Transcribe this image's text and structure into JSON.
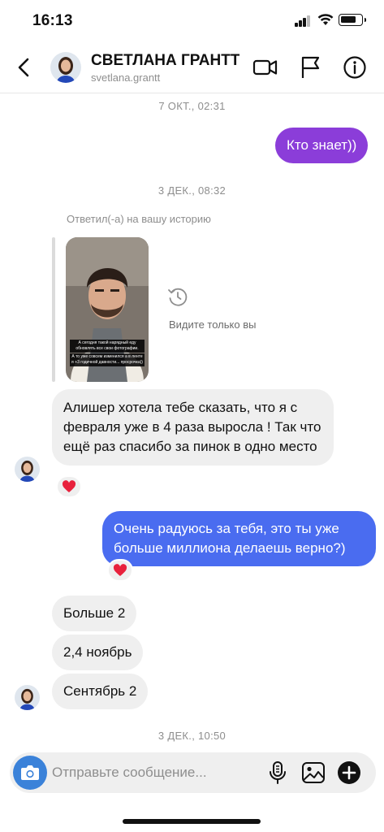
{
  "status_bar": {
    "time": "16:13"
  },
  "header": {
    "contact_name": "СВЕТЛАНА ГРАНТТ",
    "username": "svetlana.grantt",
    "icons": [
      "back-icon",
      "video-call-icon",
      "flag-icon",
      "info-icon"
    ]
  },
  "colors": {
    "outgoing_purple": "#8b3dd9",
    "outgoing_blue": "#4a6cf0",
    "incoming_bg": "#efefef",
    "reaction_heart": "#e8213c",
    "camera_blue": "#3b82d9"
  },
  "messages": {
    "ts1": "7 ОКТ., 02:31",
    "out1": "Кто знает))",
    "ts2": "3 ДЕК., 08:32",
    "reply_label": "Ответил(-а) на вашу историю",
    "story_caption_1": "А сегодня такой нарядный еду обновлять все свои фотографии.",
    "story_caption_2": "А то уже совсем изменился а в ленте я +3 годичной давности... просрочка))",
    "seen_only_you": "Видите только вы",
    "in1": "Алишер хотела тебе сказать, что я с февраля уже в 4 раза выросла ! Так что ещё раз спасибо за пинок в одно место",
    "in1_reaction": "❤️",
    "out2": "Очень радуюсь за тебя, это ты уже больше миллиона делаешь верно?)",
    "out2_reaction": "❤️",
    "in2": "Больше 2",
    "in3": "2,4 ноябрь",
    "in4": "Сентябрь 2",
    "ts3": "3 ДЕК., 10:50"
  },
  "composer": {
    "placeholder": "Отправьте сообщение...",
    "icons": [
      "camera-icon",
      "microphone-icon",
      "gallery-icon",
      "add-icon"
    ]
  }
}
